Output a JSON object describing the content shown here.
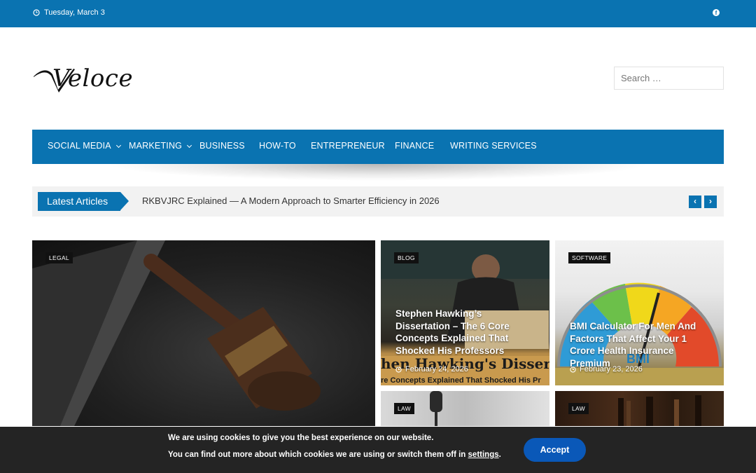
{
  "topbar": {
    "date": "Tuesday, March 3"
  },
  "brand": {
    "logo_text": "Veloce"
  },
  "search": {
    "placeholder": "Search …"
  },
  "nav": {
    "items": [
      {
        "label": "SOCIAL MEDIA",
        "has_dropdown": true
      },
      {
        "label": "MARKETING",
        "has_dropdown": true
      },
      {
        "label": "BUSINESS",
        "has_dropdown": false
      },
      {
        "label": "HOW-TO",
        "has_dropdown": false
      },
      {
        "label": "ENTREPRENEUR",
        "has_dropdown": false
      },
      {
        "label": "FINANCE",
        "has_dropdown": false
      },
      {
        "label": "WRITING SERVICES",
        "has_dropdown": false
      }
    ]
  },
  "ticker": {
    "label": "Latest Articles",
    "headline": "RKBVJRC Explained — A Modern Approach to Smarter Efficiency in 2026",
    "prev_icon": "‹",
    "next_icon": "›"
  },
  "cards": [
    {
      "category": "LEGAL",
      "title": "",
      "date": ""
    },
    {
      "category": "BLOG",
      "title": "Stephen Hawking’s Dissertation – The 6 Core Concepts Explained That Shocked His Professors",
      "date": "February 24, 2026"
    },
    {
      "category": "SOFTWARE",
      "title": "BMI Calculator For Men And Factors That Affect Your 1 Crore Health Insurance Premium",
      "date": "February 23, 2026"
    },
    {
      "category": "LAW",
      "title": "",
      "date": ""
    },
    {
      "category": "LAW",
      "title": "",
      "date": ""
    }
  ],
  "cookie": {
    "line1": "We are using cookies to give you the best experience on our website.",
    "line2_prefix": "You can find out more about which cookies we are using or switch them off in ",
    "settings_link": "settings",
    "line2_suffix": ".",
    "accept_label": "Accept"
  },
  "colors": {
    "brand_blue": "#0a73b1",
    "ticker_bg": "#f2f2f2",
    "cookie_bg": "#242424",
    "accept_button": "#0a58b8"
  }
}
